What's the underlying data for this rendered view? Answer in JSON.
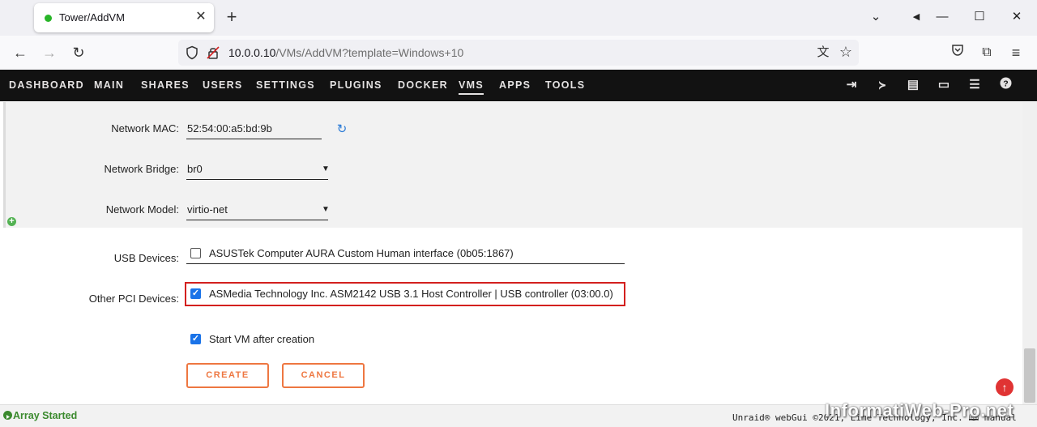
{
  "browser": {
    "tab_title": "Tower/AddVM",
    "url_host": "10.0.0.10",
    "url_path": "/VMs/AddVM?template=Windows+10"
  },
  "nav": {
    "items": [
      "DASHBOARD",
      "MAIN",
      "SHARES",
      "USERS",
      "SETTINGS",
      "PLUGINS",
      "DOCKER",
      "VMS",
      "APPS",
      "TOOLS"
    ],
    "active": "VMS"
  },
  "network": {
    "mac_label": "Network MAC:",
    "mac_value": "52:54:00:a5:bd:9b",
    "bridge_label": "Network Bridge:",
    "bridge_value": "br0",
    "model_label": "Network Model:",
    "model_value": "virtio-net"
  },
  "devices": {
    "usb_label": "USB Devices:",
    "usb_item": "ASUSTek Computer AURA Custom Human interface (0b05:1867)",
    "usb_checked": false,
    "pci_label": "Other PCI Devices:",
    "pci_item": "ASMedia Technology Inc. ASM2142 USB 3.1 Host Controller | USB controller (03:00.0)",
    "pci_checked": true,
    "start_label": "Start VM after creation",
    "start_checked": true
  },
  "buttons": {
    "create": "CREATE",
    "cancel": "CANCEL"
  },
  "footer": {
    "status": "Array Started",
    "copyright": "Unraid® webGui ©2021, Lime Technology, Inc. 🕮 manual"
  },
  "watermark": "InformatiWeb-Pro.net",
  "colors": {
    "accent": "#ee7741",
    "highlight": "#d3201e",
    "checkbox": "#1a73e8",
    "nav_bg": "#121212",
    "status_green": "#3b8a2e"
  }
}
